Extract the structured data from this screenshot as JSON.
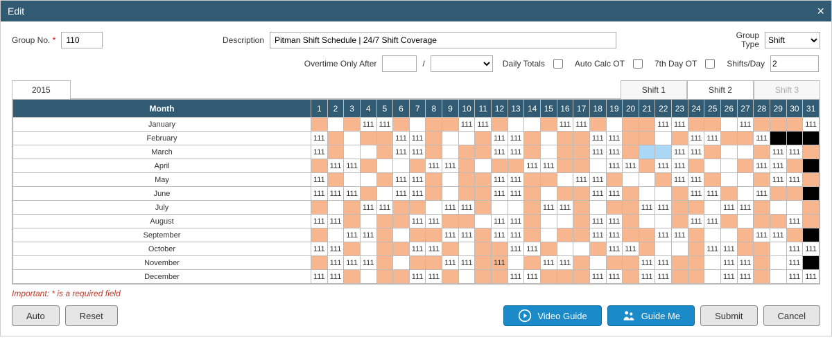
{
  "title": "Edit",
  "form": {
    "group_no_label": "Group No.",
    "group_no_value": "110",
    "description_label": "Description",
    "description_value": "Pitman Shift Schedule | 24/7 Shift Coverage",
    "group_type_label": "Group Type",
    "group_type_value": "Shift",
    "overtime_label": "Overtime Only After",
    "overtime_value": "",
    "overtime_sep": "/",
    "overtime_select": "",
    "daily_totals_label": "Daily Totals",
    "daily_totals_checked": false,
    "auto_calc_ot_label": "Auto Calc OT",
    "auto_calc_ot_checked": false,
    "seventh_day_ot_label": "7th Day OT",
    "seventh_day_ot_checked": false,
    "shifts_day_label": "Shifts/Day",
    "shifts_day_value": "2"
  },
  "year_tab": "2015",
  "shift_tabs": [
    "Shift 1",
    "Shift 2",
    "Shift 3"
  ],
  "active_shift_tab": 1,
  "table": {
    "month_header": "Month",
    "months": [
      "January",
      "February",
      "March",
      "April",
      "May",
      "June",
      "July",
      "August",
      "September",
      "October",
      "November",
      "December"
    ],
    "days_in_month": [
      31,
      28,
      31,
      30,
      31,
      30,
      31,
      31,
      30,
      31,
      30,
      31
    ],
    "cell_text": "111",
    "legend": {
      "w": "white-empty",
      "v": "white-111",
      "o": "orange-empty",
      "b": "blue-empty",
      "x": "black-invalid"
    },
    "pattern": [
      "owovvowoovvowwovvowoovvoowvooov",
      "vowoovvowwovvowoovvoowovvoovxxx",
      "vowwovvowoovvowoovvobbvvowwovvo",
      "ovvowwovvowoovvoowvvovvowwovvov",
      "vowwovvowoovvoowvvowwovvowwovvo",
      "vvvowvvowoovvowoovvowwovvowvoov",
      "owovvoowvvowwovvowoovvoowvvowwo",
      "vvowoovvoowvvowwovvowwovvowoovo",
      "owvvowoovvovvowoovvoovvowwovvow",
      "vvowoovvowoovvowwovvowwovvoowvv",
      "ovvvowoovvogwovvowoovvoowvvowvv",
      "vvowoovvowoovvooovvovvoowvvowvv"
    ]
  },
  "note": "Important: * is a required field",
  "buttons": {
    "auto": "Auto",
    "reset": "Reset",
    "video_guide": "Video Guide",
    "guide_me": "Guide Me",
    "submit": "Submit",
    "cancel": "Cancel"
  },
  "colors": {
    "header_bg": "#315a73",
    "orange": "#f7b68e",
    "blue_hl": "#a9d7f5",
    "btn_blue": "#1a8ac9"
  }
}
